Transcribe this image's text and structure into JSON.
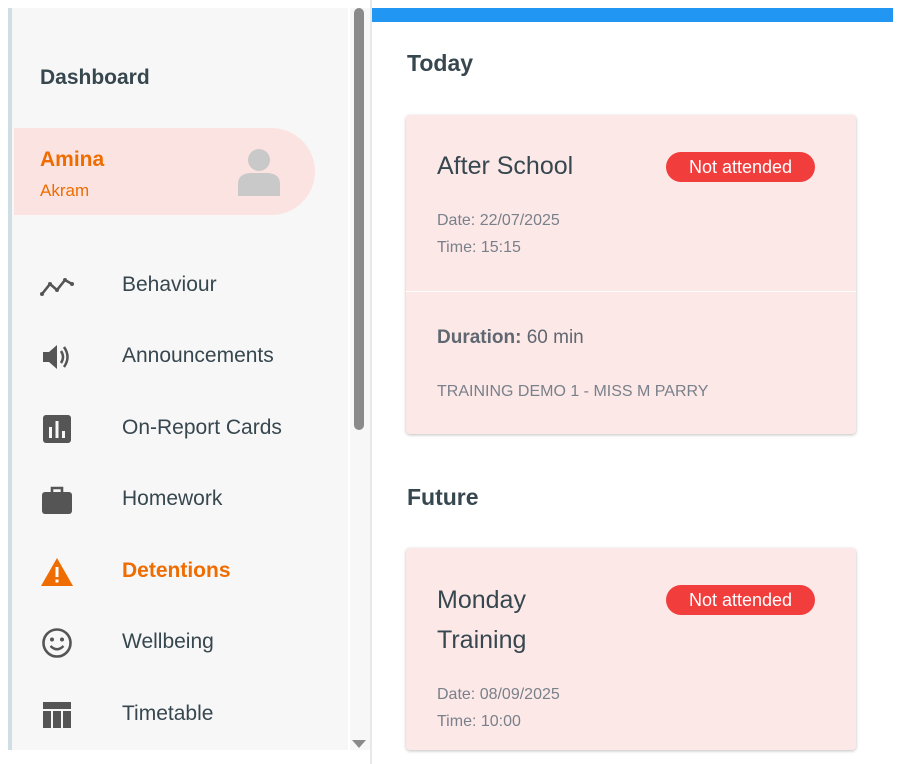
{
  "sidebar": {
    "title": "Dashboard",
    "user": {
      "first_name": "Amina",
      "last_name": "Akram"
    },
    "items": [
      {
        "label": "Behaviour",
        "icon": "behaviour-trend-icon",
        "active": false
      },
      {
        "label": "Announcements",
        "icon": "speaker-icon",
        "active": false
      },
      {
        "label": "On-Report Cards",
        "icon": "bar-chart-icon",
        "active": false
      },
      {
        "label": "Homework",
        "icon": "briefcase-icon",
        "active": false
      },
      {
        "label": "Detentions",
        "icon": "warning-icon",
        "active": true
      },
      {
        "label": "Wellbeing",
        "icon": "smiley-icon",
        "active": false
      },
      {
        "label": "Timetable",
        "icon": "timetable-icon",
        "active": false
      }
    ]
  },
  "colors": {
    "accent": "#ef6c00",
    "top_bar": "#2196f3",
    "badge": "#f23d3d",
    "card": "#fde8e8"
  },
  "main": {
    "today": {
      "heading": "Today",
      "card": {
        "title": "After School",
        "status": "Not attended",
        "date": "Date: 22/07/2025",
        "time": "Time: 15:15",
        "duration_label": "Duration:",
        "duration_value": "60 min",
        "teacher": "TRAINING DEMO 1 - MISS M PARRY"
      }
    },
    "future": {
      "heading": "Future",
      "card": {
        "title_line1": "Monday",
        "title_line2": "Training",
        "status": "Not attended",
        "date": "Date: 08/09/2025",
        "time": "Time: 10:00"
      }
    }
  }
}
